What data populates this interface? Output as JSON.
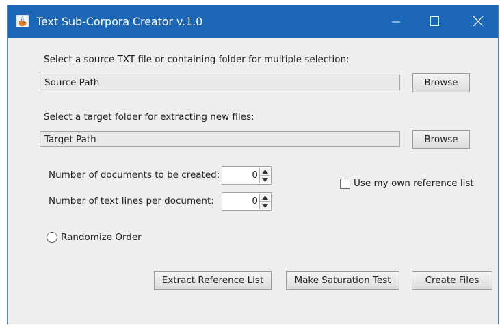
{
  "window": {
    "title": "Text Sub-Corpora Creator v.1.0",
    "app_icon": "java-cup-icon",
    "controls": [
      "minimize-icon",
      "maximize-icon",
      "close-icon"
    ]
  },
  "source": {
    "label": "Select a source TXT file or containing folder for multiple selection:",
    "value": "Source Path",
    "browse_label": "Browse"
  },
  "target": {
    "label": "Select a target folder for extracting new files:",
    "value": "Target Path",
    "browse_label": "Browse"
  },
  "options": {
    "num_docs_label": "Number of documents to be created:",
    "num_docs_value": "0",
    "num_lines_label": "Number of text lines per document:",
    "num_lines_value": "0",
    "reference_list_label": "Use my own reference list",
    "reference_list_checked": false,
    "randomize_label": "Randomize Order",
    "randomize_selected": false
  },
  "actions": {
    "extract_label": "Extract Reference List",
    "saturation_label": "Make Saturation Test",
    "create_label": "Create Files"
  },
  "colors": {
    "titlebar": "#1b67b6",
    "panel": "#eeeeee"
  }
}
